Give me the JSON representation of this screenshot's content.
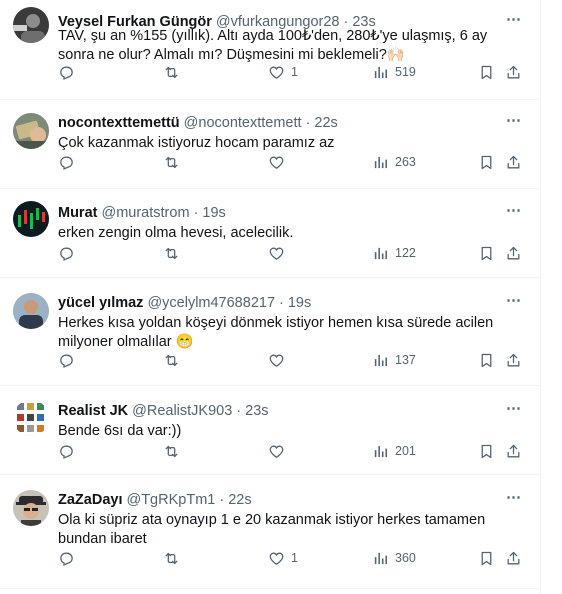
{
  "tweets": [
    {
      "name": "Veysel Furkan Güngör",
      "handle": "@vfurkangungor28",
      "time": "23s",
      "text": "TAV, şu an %155 (yıllık). Altı ayda 100₺'den, 280₺'ye ulaşmış, 6 ay sonra ne olur? Almalı mı? Düşmesini mi beklemeli?🙌🏻",
      "likes": "1",
      "views": "519",
      "avatar": "dark-portrait"
    },
    {
      "name": "nocontexttemettü",
      "handle": "@nocontexttemett",
      "time": "22s",
      "text": "Çok kazanmak istiyoruz hocam paramız az",
      "likes": "",
      "views": "263",
      "avatar": "money-hand"
    },
    {
      "name": "Murat",
      "handle": "@muratstrom",
      "time": "19s",
      "text": "erken zengin olma hevesi, acelecilik.",
      "likes": "",
      "views": "122",
      "avatar": "chart-dark"
    },
    {
      "name": "yücel yılmaz",
      "handle": "@ycelylm47688217",
      "time": "19s",
      "text": "Herkes kısa yoldan köşeyi dönmek istiyor hemen kısa sürede acilen milyoner  olmalılar 😁",
      "likes": "",
      "views": "137",
      "avatar": "man-jacket"
    },
    {
      "name": "Realist JK",
      "handle": "@RealistJK903",
      "time": "23s",
      "text": "Bende 6sı da var:))",
      "likes": "",
      "views": "201",
      "avatar": "grid-icons"
    },
    {
      "name": "ZaZaDayı",
      "handle": "@TgRKpTm1",
      "time": "22s",
      "text": "Ola ki süpriz ata oynayıp 1 e 20 kazanmak istiyor herkes tamamen bundan ibaret",
      "likes": "1",
      "views": "360",
      "avatar": "man-hat-glasses"
    }
  ],
  "more_icon": "⋯",
  "icons": [
    "reply-icon",
    "retweet-icon",
    "like-icon",
    "views-icon",
    "bookmark-icon",
    "share-icon"
  ]
}
